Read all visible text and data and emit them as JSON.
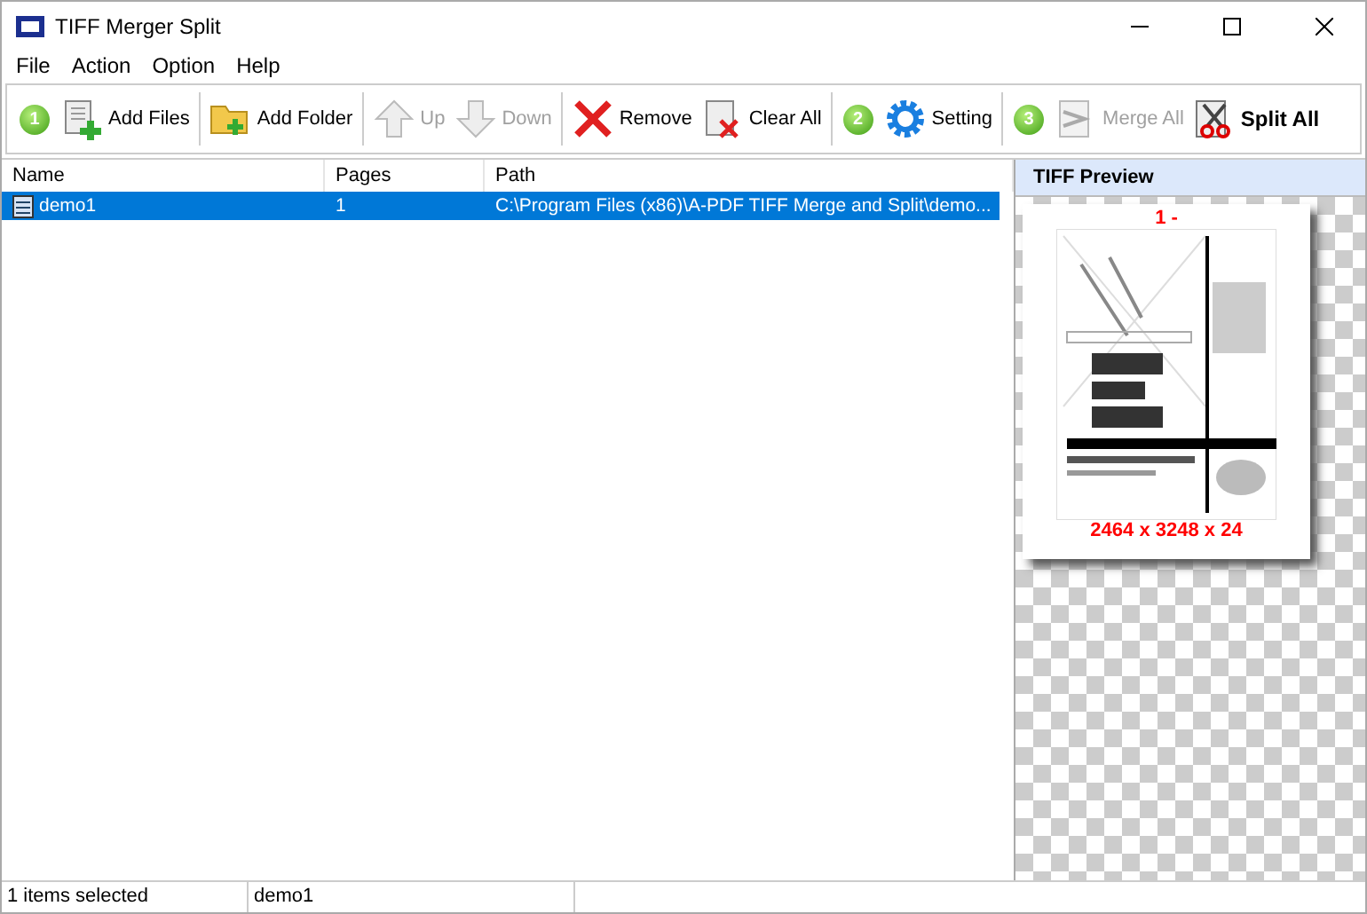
{
  "window": {
    "title": "TIFF Merger Split"
  },
  "menu": [
    "File",
    "Action",
    "Option",
    "Help"
  ],
  "toolbar": [
    {
      "kind": "step",
      "label": "1"
    },
    {
      "kind": "button",
      "label": "Add Files",
      "disabled": false,
      "bold": false
    },
    {
      "kind": "separator"
    },
    {
      "kind": "button",
      "label": "Add Folder",
      "disabled": false,
      "bold": false
    },
    {
      "kind": "separator"
    },
    {
      "kind": "button",
      "label": "Up",
      "disabled": true,
      "bold": false
    },
    {
      "kind": "button",
      "label": "Down",
      "disabled": true,
      "bold": false
    },
    {
      "kind": "separator"
    },
    {
      "kind": "button",
      "label": "Remove",
      "disabled": false,
      "bold": false
    },
    {
      "kind": "button",
      "label": "Clear All",
      "disabled": false,
      "bold": false
    },
    {
      "kind": "separator"
    },
    {
      "kind": "step",
      "label": "2"
    },
    {
      "kind": "button",
      "label": "Setting",
      "disabled": false,
      "bold": false
    },
    {
      "kind": "separator"
    },
    {
      "kind": "step",
      "label": "3"
    },
    {
      "kind": "button",
      "label": "Merge All",
      "disabled": true,
      "bold": false
    },
    {
      "kind": "button",
      "label": "Split All",
      "disabled": false,
      "bold": true
    }
  ],
  "table": {
    "columns": [
      "Name",
      "Pages",
      "Path"
    ],
    "rows": [
      {
        "name": "demo1",
        "pages": "1",
        "path": "C:\\Program Files (x86)\\A-PDF TIFF Merge and Split\\demo...",
        "selected": true
      }
    ]
  },
  "preview": {
    "title": "TIFF Preview",
    "page_label": "1 -",
    "dimensions": "2464 x 3248 x 24"
  },
  "status_bar": [
    "1 items selected",
    "demo1"
  ]
}
